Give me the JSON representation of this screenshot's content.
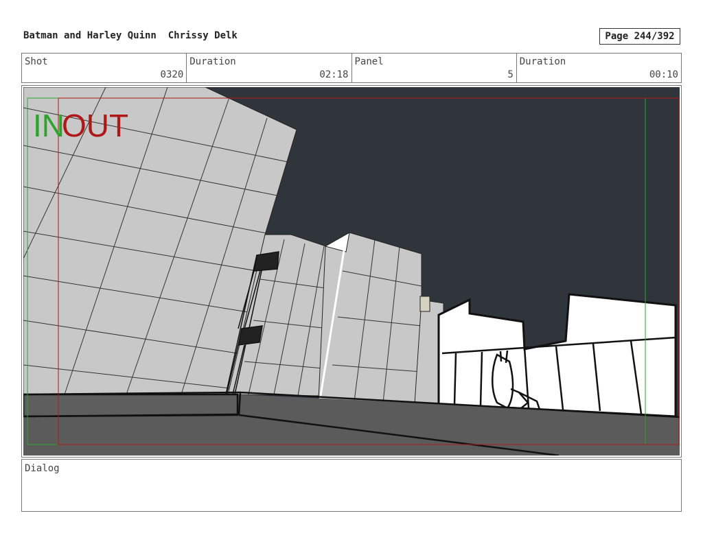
{
  "header": {
    "title": "Batman and Harley Quinn  Chrissy Delk",
    "page": "Page 244/392"
  },
  "meta": {
    "shot_label": "Shot",
    "shot_value": "0320",
    "duration_label": "Duration",
    "duration_value": "02:18",
    "panel_label": "Panel",
    "panel_value": "5",
    "panel_duration_label": "Duration",
    "panel_duration_value": "00:10"
  },
  "panel": {
    "in_marker": "IN",
    "out_marker": "OUT",
    "colors": {
      "sky": "#30353b",
      "in": "#2aa52a",
      "out": "#b01818",
      "building": "#c8c8c8",
      "ground": "#5b5b5b"
    }
  },
  "dialog": {
    "label": "Dialog"
  }
}
